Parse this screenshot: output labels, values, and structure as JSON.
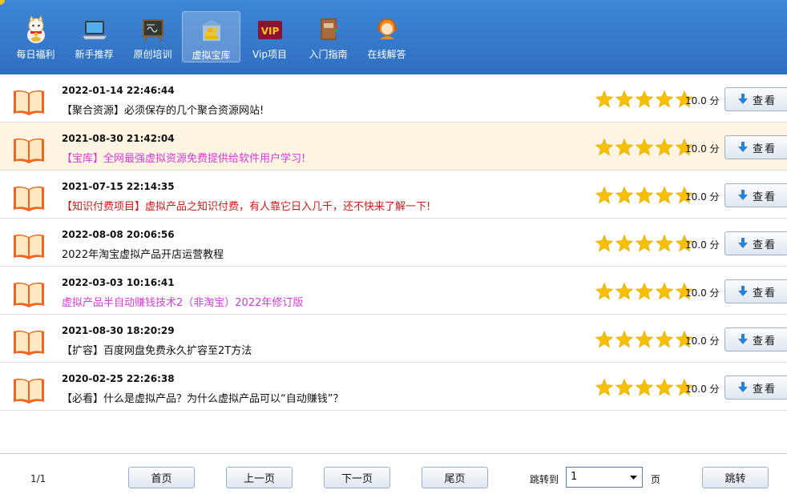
{
  "nav": {
    "items": [
      {
        "label": "每日福利",
        "icon": "lucky-cat-icon",
        "active": false
      },
      {
        "label": "新手推荐",
        "icon": "laptop-icon",
        "active": false
      },
      {
        "label": "原创培训",
        "icon": "chalkboard-icon",
        "active": false
      },
      {
        "label": "虚拟宝库",
        "icon": "treasure-box-icon",
        "active": true
      },
      {
        "label": "Vip项目",
        "icon": "vip-badge-icon",
        "active": false
      },
      {
        "label": "入门指南",
        "icon": "guide-book-icon",
        "active": false
      },
      {
        "label": "在线解答",
        "icon": "support-agent-icon",
        "active": false
      }
    ],
    "vip_badge_text": "VIP"
  },
  "list": {
    "rows": [
      {
        "date": "2022-01-14 22:46:44",
        "title": "【聚合资源】必须保存的几个聚合资源网站!",
        "style": "normal",
        "rating": 5,
        "score": "10.0 分",
        "button": "查看",
        "highlight": false
      },
      {
        "date": "2021-08-30 21:42:04",
        "title": "【宝库】全网最强虚拟资源免费提供给软件用户学习!",
        "style": "pink",
        "rating": 5,
        "score": "10.0 分",
        "button": "查看",
        "highlight": true
      },
      {
        "date": "2021-07-15 22:14:35",
        "title": "【知识付费项目】虚拟产品之知识付费，有人靠它日入几千，还不快来了解一下!",
        "style": "red",
        "rating": 5,
        "score": "10.0 分",
        "button": "查看",
        "highlight": false
      },
      {
        "date": "2022-08-08 20:06:56",
        "title": "2022年淘宝虚拟产品开店运营教程",
        "style": "normal",
        "rating": 5,
        "score": "10.0 分",
        "button": "查看",
        "highlight": false
      },
      {
        "date": "2022-03-03 10:16:41",
        "title": "虚拟产品半自动赚钱技术2（非淘宝）2022年修订版",
        "style": "pink",
        "rating": 5,
        "score": "10.0 分",
        "button": "查看",
        "highlight": false
      },
      {
        "date": "2021-08-30 18:20:29",
        "title": "【扩容】百度网盘免费永久扩容至2T方法",
        "style": "normal",
        "rating": 5,
        "score": "10.0 分",
        "button": "查看",
        "highlight": false
      },
      {
        "date": "2020-02-25 22:26:38",
        "title": "【必看】什么是虚拟产品？为什么虚拟产品可以“自动赚钱”？",
        "style": "normal",
        "rating": 5,
        "score": "10.0 分",
        "button": "查看",
        "highlight": false
      }
    ]
  },
  "pager": {
    "info": "1/1",
    "first": "首页",
    "prev": "上一页",
    "next": "下一页",
    "last": "尾页",
    "jump_label": "跳转到",
    "jump_value": "1",
    "page_suffix": "页",
    "jump_button": "跳转"
  },
  "colors": {
    "topbar": "#3a7fd0",
    "highlight_row": "#fdf5e1",
    "pink_title": "#d63bd6",
    "red_title": "#d01818",
    "star": "#f6c000"
  }
}
